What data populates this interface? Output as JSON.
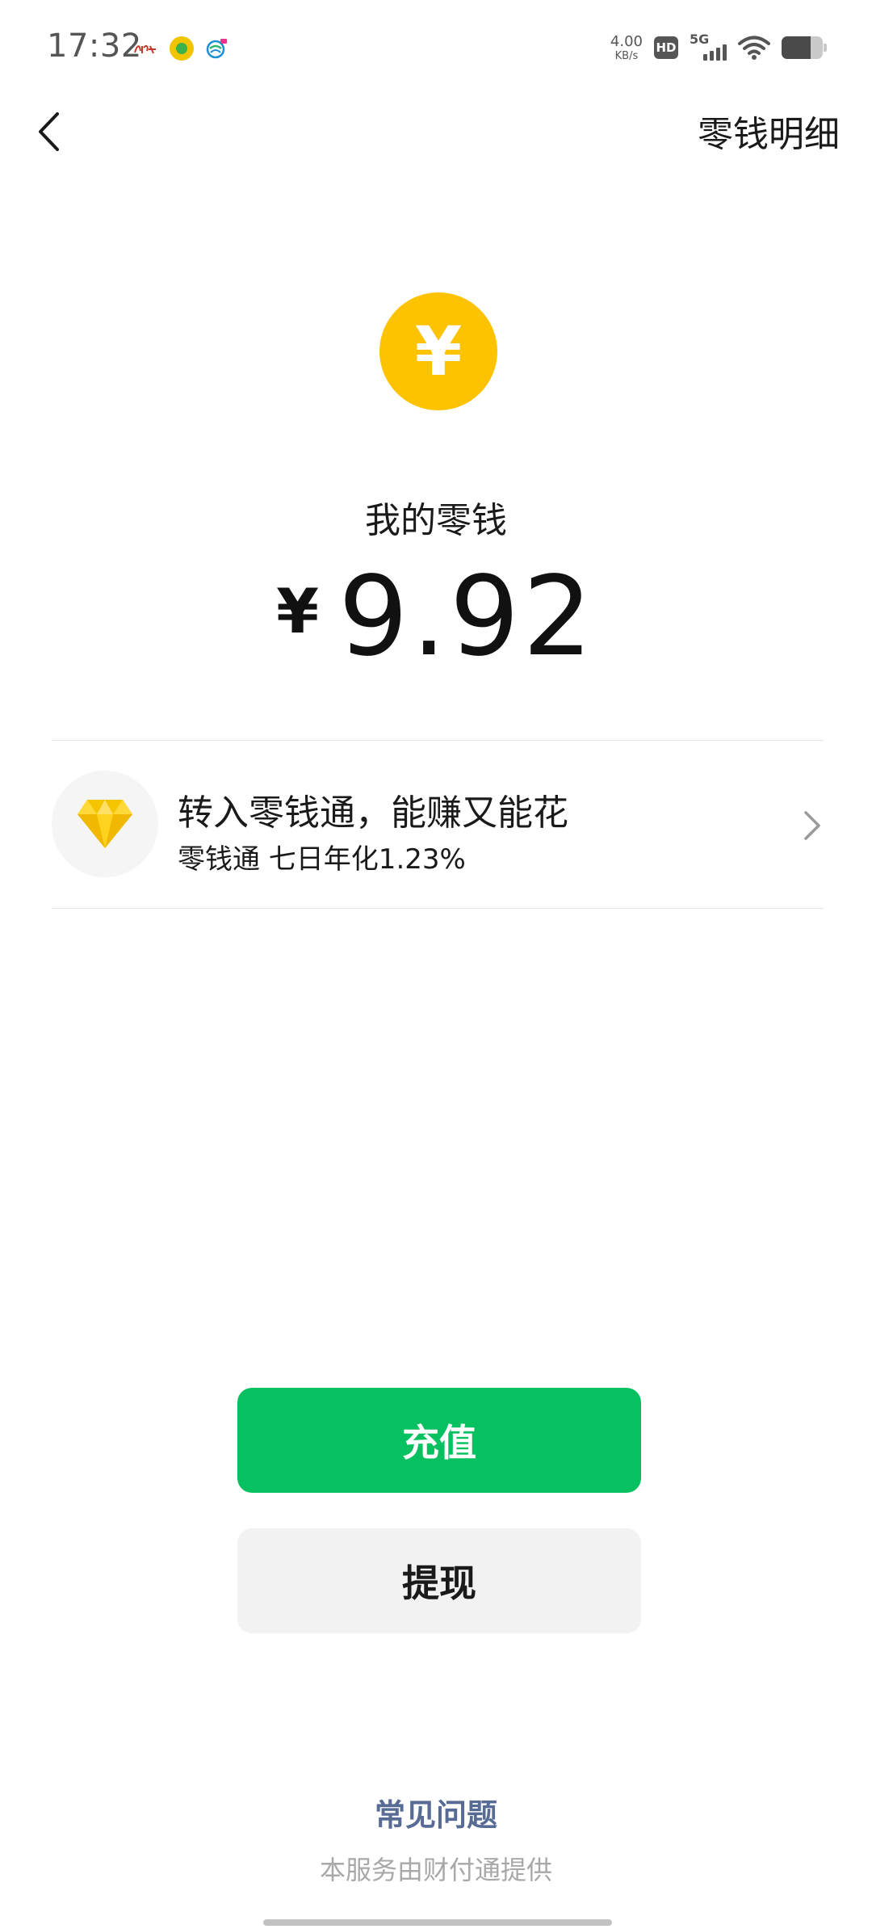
{
  "status_bar": {
    "time": "17:32",
    "net_speed_value": "4.00",
    "net_speed_unit": "KB/s",
    "hd_label": "HD",
    "network_type": "5G",
    "battery_level": 0.7,
    "icons": [
      "news-app-icon",
      "music-app-icon",
      "china-mobile-icon",
      "hd-icon",
      "signal-icon",
      "wifi-icon",
      "battery-icon"
    ]
  },
  "nav": {
    "back_icon": "chevron-left-icon",
    "details_label": "零钱明细"
  },
  "balance": {
    "badge_glyph": "¥",
    "title": "我的零钱",
    "currency_sign": "¥",
    "amount": "9.92"
  },
  "lingqiantong": {
    "icon": "diamond-icon",
    "title": "转入零钱通，能赚又能花",
    "subtitle": "零钱通 七日年化1.23%"
  },
  "actions": {
    "topup_label": "充值",
    "withdraw_label": "提现"
  },
  "footer": {
    "faq_label": "常见问题",
    "provider_note": "本服务由财付通提供"
  },
  "colors": {
    "primary_green": "#07c160",
    "coin_yellow": "#fdc200",
    "link_blue": "#576b95"
  }
}
